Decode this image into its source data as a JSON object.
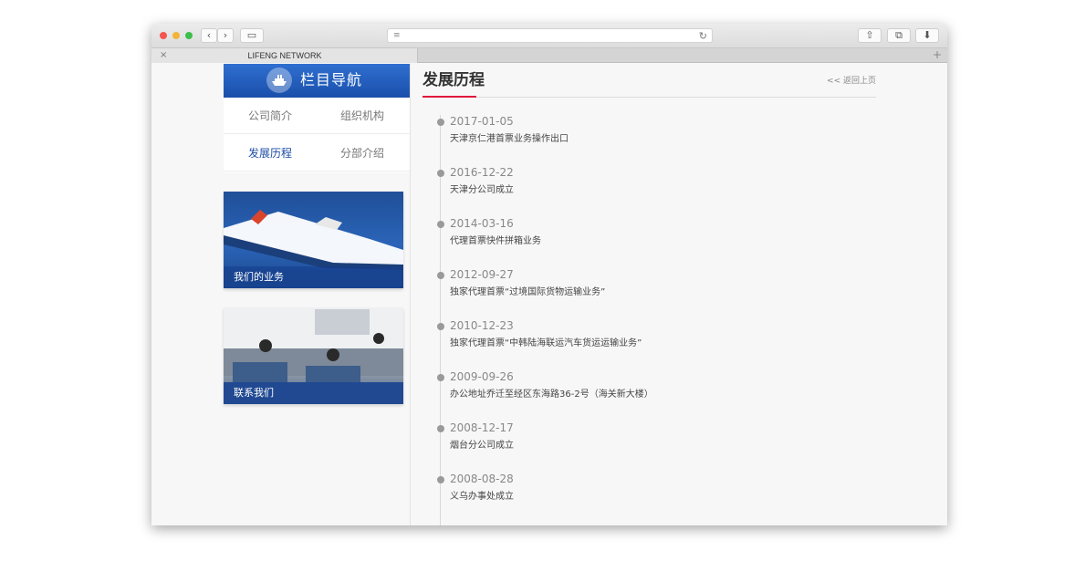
{
  "browser": {
    "tab_title": "LIFENG NETWORK",
    "tab_close": "×",
    "new_tab": "+",
    "back": "‹",
    "forward": "›",
    "sidebar_toggle": "▭",
    "reader": "≡",
    "reload": "↻",
    "share": "⇧",
    "tabs": "⧉",
    "download": "⬇"
  },
  "sidebar": {
    "title": "栏目导航",
    "items": [
      {
        "label": "公司简介",
        "active": false
      },
      {
        "label": "组织机构",
        "active": false
      },
      {
        "label": "发展历程",
        "active": true
      },
      {
        "label": "分部介绍",
        "active": false
      }
    ],
    "promos": [
      {
        "label": "我们的业务",
        "image": "cruise-ship-photo"
      },
      {
        "label": "联系我们",
        "image": "office-photo"
      }
    ]
  },
  "main": {
    "title": "发展历程",
    "back_link": "<< 返回上页",
    "events": [
      {
        "date": "2017-01-05",
        "desc": "天津京仁港首票业务操作出口"
      },
      {
        "date": "2016-12-22",
        "desc": "天津分公司成立"
      },
      {
        "date": "2014-03-16",
        "desc": "代理首票快件拼箱业务"
      },
      {
        "date": "2012-09-27",
        "desc": "独家代理首票“过境国际货物运输业务”"
      },
      {
        "date": "2010-12-23",
        "desc": "独家代理首票“中韩陆海联运汽车货运运输业务”"
      },
      {
        "date": "2009-09-26",
        "desc": "办公地址乔迁至经区东海路36-2号（海关新大楼）"
      },
      {
        "date": "2008-12-17",
        "desc": "烟台分公司成立"
      },
      {
        "date": "2008-08-28",
        "desc": "义乌办事处成立"
      }
    ]
  },
  "colors": {
    "nav_header": "#1f56b4",
    "accent_red": "#e0163a",
    "active_nav": "#1d4ea6"
  }
}
